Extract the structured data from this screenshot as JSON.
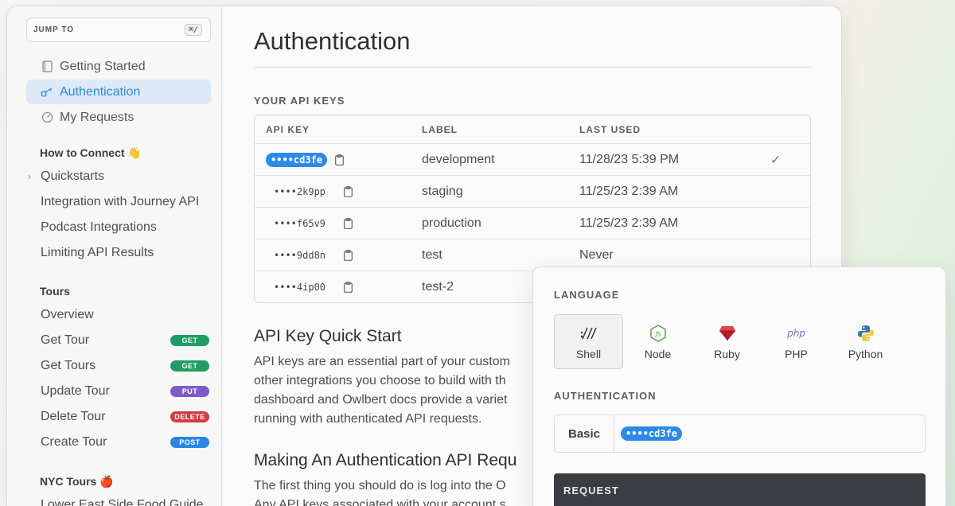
{
  "sidebar": {
    "jump_label": "JUMP TO",
    "jump_kbd": "⌘/",
    "top_items": [
      {
        "label": "Getting Started",
        "icon": "book-icon"
      },
      {
        "label": "Authentication",
        "icon": "key-icon",
        "active": true
      },
      {
        "label": "My Requests",
        "icon": "gauge-icon"
      }
    ],
    "how_to_connect": {
      "title": "How to Connect 👋",
      "items": [
        "Quickstarts",
        "Integration with Journey API",
        "Podcast Integrations",
        "Limiting API Results"
      ]
    },
    "tours": {
      "title": "Tours",
      "items": [
        {
          "label": "Overview",
          "method": ""
        },
        {
          "label": "Get Tour",
          "method": "GET",
          "color": "#1f9d64"
        },
        {
          "label": "Get Tours",
          "method": "GET",
          "color": "#1f9d64"
        },
        {
          "label": "Update Tour",
          "method": "PUT",
          "color": "#7b5cc9"
        },
        {
          "label": "Delete Tour",
          "method": "DELETE",
          "color": "#d13d45"
        },
        {
          "label": "Create Tour",
          "method": "POST",
          "color": "#2a86e0"
        }
      ]
    },
    "nyc_tours": {
      "title": "NYC Tours 🍎",
      "items": [
        "Lower East Side Food Guide"
      ]
    }
  },
  "main": {
    "title": "Authentication",
    "keys_label": "YOUR API KEYS",
    "table": {
      "headers": [
        "API KEY",
        "LABEL",
        "LAST USED"
      ],
      "rows": [
        {
          "key": "••••cd3fe",
          "label": "development",
          "last_used": "11/28/23 5:39 PM",
          "selected": true,
          "check": "✓"
        },
        {
          "key": "••••2k9pp",
          "label": "staging",
          "last_used": "11/25/23 2:39 AM"
        },
        {
          "key": "••••f65v9",
          "label": "production",
          "last_used": "11/25/23 2:39 AM"
        },
        {
          "key": "••••9dd8n",
          "label": "test",
          "last_used": "Never"
        },
        {
          "key": "••••4ip00",
          "label": "test-2",
          "last_used": ""
        }
      ]
    },
    "quickstart_title": "API Key Quick Start",
    "quickstart_lines": [
      "API keys are an essential part of your custom",
      "other integrations you choose to build with th",
      "dashboard and Owlbert docs provide a variet",
      "running with authenticated API requests."
    ],
    "making_title": "Making An Authentication API Requ",
    "making_lines": [
      "The first thing you should do is log into the O",
      "Any API keys associated with your account s"
    ]
  },
  "popup": {
    "language_label": "LANGUAGE",
    "languages": [
      {
        "name": "Shell",
        "icon": "shell-icon",
        "selected": true
      },
      {
        "name": "Node",
        "icon": "nodejs-icon"
      },
      {
        "name": "Ruby",
        "icon": "ruby-icon"
      },
      {
        "name": "PHP",
        "icon": "php-icon"
      },
      {
        "name": "Python",
        "icon": "python-icon"
      }
    ],
    "php_logo_text": "php",
    "auth_label": "AUTHENTICATION",
    "auth_type": "Basic",
    "auth_value": "••••cd3fe",
    "request_label": "REQUEST"
  }
}
